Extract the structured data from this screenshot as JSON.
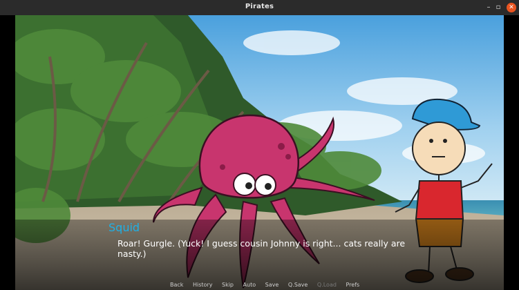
{
  "window": {
    "title": "Pirates"
  },
  "dialogue": {
    "speaker": "Squid",
    "text": "Roar! Gurgle. (Yuck! I guess cousin Johnny is right... cats really are nasty.)"
  },
  "quick_menu": [
    {
      "label": "Back",
      "enabled": true
    },
    {
      "label": "History",
      "enabled": true
    },
    {
      "label": "Skip",
      "enabled": true
    },
    {
      "label": "Auto",
      "enabled": true
    },
    {
      "label": "Save",
      "enabled": true
    },
    {
      "label": "Q.Save",
      "enabled": true
    },
    {
      "label": "Q.Load",
      "enabled": false
    },
    {
      "label": "Prefs",
      "enabled": true
    }
  ],
  "colors": {
    "speaker": "#1fb0e6",
    "octopus": "#c8356e",
    "shirt": "#d9272e",
    "cap": "#2f9ad6"
  }
}
